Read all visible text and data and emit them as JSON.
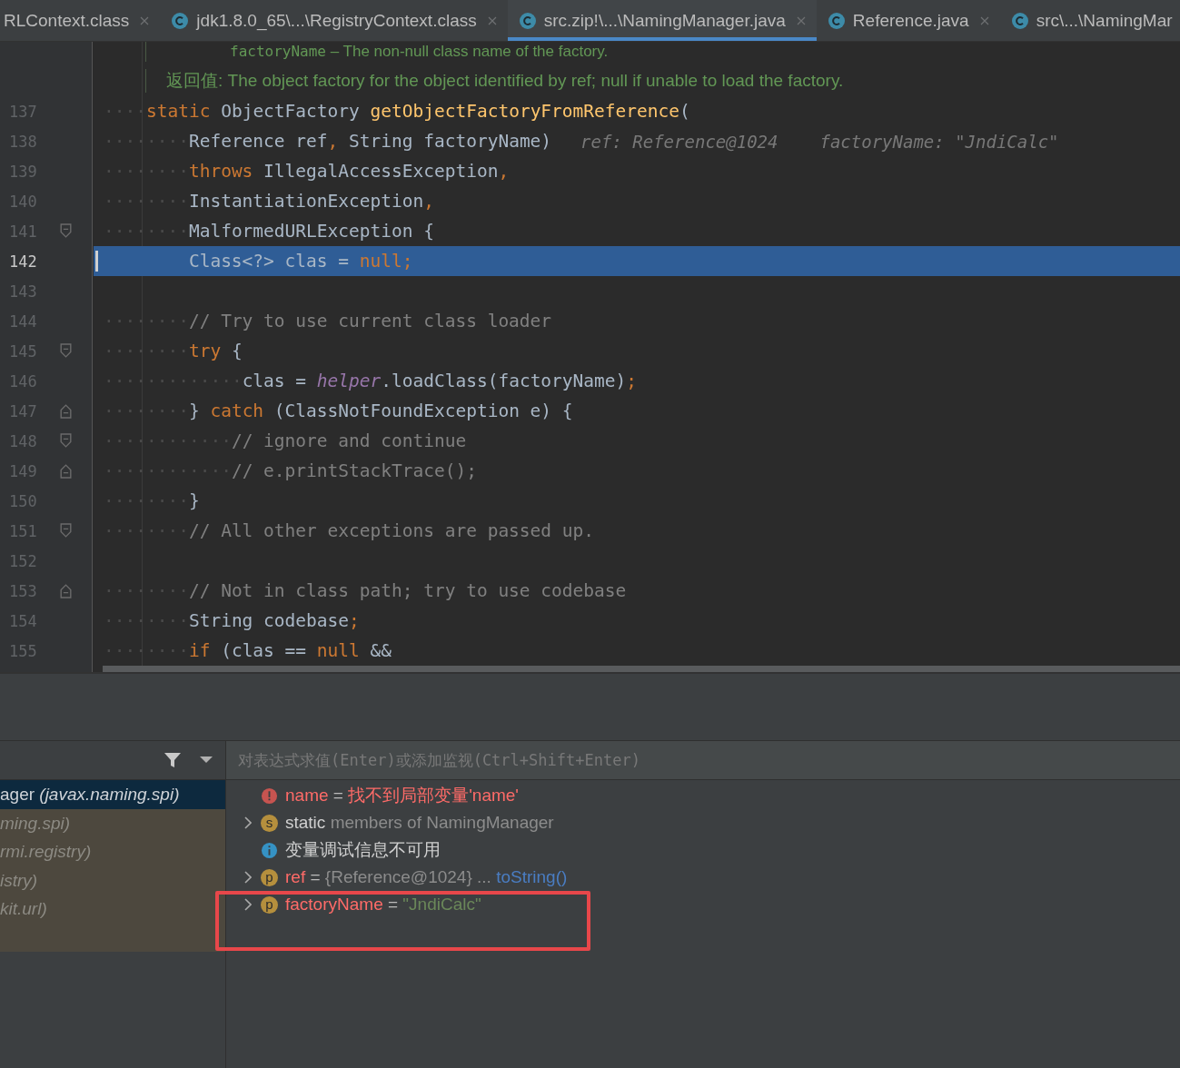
{
  "tabs": [
    {
      "label": "RLContext.class",
      "selected": false
    },
    {
      "label": "jdk1.8.0_65\\...\\RegistryContext.class",
      "selected": false
    },
    {
      "label": "src.zip!\\...\\NamingManager.java",
      "selected": true
    },
    {
      "label": "Reference.java",
      "selected": false
    },
    {
      "label": "src\\...\\NamingMar",
      "selected": false
    }
  ],
  "doc_lines": [
    {
      "indented": true,
      "tokens": [
        {
          "kind": "mono",
          "text": "factoryName"
        },
        {
          "kind": "sans",
          "text": " – The non-null class name of the factory."
        }
      ]
    },
    {
      "indented": false,
      "tokens": [
        {
          "kind": "sans",
          "text": "返回值: The object factory for the object identified by ref; null if unable to load the factory."
        }
      ]
    }
  ],
  "code_lines": [
    {
      "number": "137",
      "selected": false,
      "kind": "plain",
      "tokens": [
        {
          "kind": "ws",
          "text": "····"
        },
        {
          "kind": "kw",
          "text": "static"
        },
        {
          "kind": "plain",
          "text": " ObjectFactory "
        },
        {
          "kind": "fn",
          "text": "getObjectFactoryFromReference"
        },
        {
          "kind": "plain",
          "text": "("
        }
      ]
    },
    {
      "number": "138",
      "selected": false,
      "kind": "plain",
      "tokens": [
        {
          "kind": "ws",
          "text": "········"
        },
        {
          "kind": "plain",
          "text": "Reference ref"
        },
        {
          "kind": "kw",
          "text": ","
        },
        {
          "kind": "plain",
          "text": " String factoryName)"
        }
      ],
      "hints": [
        "ref: Reference@1024",
        "factoryName: \"JndiCalc\""
      ]
    },
    {
      "number": "139",
      "selected": false,
      "kind": "plain",
      "tokens": [
        {
          "kind": "ws",
          "text": "········"
        },
        {
          "kind": "kw",
          "text": "throws"
        },
        {
          "kind": "plain",
          "text": " IllegalAccessException"
        },
        {
          "kind": "kw",
          "text": ","
        }
      ]
    },
    {
      "number": "140",
      "selected": false,
      "kind": "plain",
      "tokens": [
        {
          "kind": "ws",
          "text": "········"
        },
        {
          "kind": "plain",
          "text": "InstantiationException"
        },
        {
          "kind": "kw",
          "text": ","
        }
      ]
    },
    {
      "number": "141",
      "selected": false,
      "kind": "fold-start",
      "tokens": [
        {
          "kind": "ws",
          "text": "········"
        },
        {
          "kind": "plain",
          "text": "MalformedURLException {"
        }
      ]
    },
    {
      "number": "142",
      "selected": true,
      "kind": "plain",
      "tokens": [
        {
          "kind": "plain",
          "text": "Class<?> clas = "
        },
        {
          "kind": "kw",
          "text": "null;"
        }
      ]
    },
    {
      "number": "143",
      "selected": false,
      "kind": "plain"
    },
    {
      "number": "144",
      "selected": false,
      "kind": "plain",
      "tokens": [
        {
          "kind": "ws",
          "text": "········"
        },
        {
          "kind": "comment",
          "text": "// Try to use current class loader"
        }
      ]
    },
    {
      "number": "145",
      "selected": false,
      "kind": "fold-start",
      "tokens": [
        {
          "kind": "ws",
          "text": "········"
        },
        {
          "kind": "kw",
          "text": "try"
        },
        {
          "kind": "plain",
          "text": " {"
        }
      ]
    },
    {
      "number": "146",
      "selected": false,
      "kind": "plain",
      "tokens": [
        {
          "kind": "ws",
          "text": "·············"
        },
        {
          "kind": "plain",
          "text": "clas = "
        },
        {
          "kind": "field",
          "text": "helper"
        },
        {
          "kind": "plain",
          "text": ".loadClass(factoryName)"
        },
        {
          "kind": "kw",
          "text": ";"
        }
      ]
    },
    {
      "number": "147",
      "selected": false,
      "kind": "fold-end",
      "tokens": [
        {
          "kind": "ws",
          "text": "········"
        },
        {
          "kind": "plain",
          "text": "} "
        },
        {
          "kind": "kw",
          "text": "catch"
        },
        {
          "kind": "plain",
          "text": " (ClassNotFoundException e) {"
        }
      ]
    },
    {
      "number": "148",
      "selected": false,
      "kind": "fold-start",
      "tokens": [
        {
          "kind": "ws",
          "text": "············"
        },
        {
          "kind": "comment",
          "text": "// ignore and continue"
        }
      ]
    },
    {
      "number": "149",
      "selected": false,
      "kind": "fold-end",
      "tokens": [
        {
          "kind": "ws",
          "text": "············"
        },
        {
          "kind": "comment",
          "text": "// e.printStackTrace();"
        }
      ]
    },
    {
      "number": "150",
      "selected": false,
      "kind": "plain",
      "tokens": [
        {
          "kind": "ws",
          "text": "········"
        },
        {
          "kind": "plain",
          "text": "}"
        }
      ]
    },
    {
      "number": "151",
      "selected": false,
      "kind": "fold-start",
      "tokens": [
        {
          "kind": "ws",
          "text": "········"
        },
        {
          "kind": "comment",
          "text": "// All other exceptions are passed up."
        }
      ]
    },
    {
      "number": "152",
      "selected": false,
      "kind": "plain"
    },
    {
      "number": "153",
      "selected": false,
      "kind": "fold-end",
      "tokens": [
        {
          "kind": "ws",
          "text": "········"
        },
        {
          "kind": "comment",
          "text": "// Not in class path; try to use codebase"
        }
      ]
    },
    {
      "number": "154",
      "selected": false,
      "kind": "plain",
      "tokens": [
        {
          "kind": "ws",
          "text": "········"
        },
        {
          "kind": "plain",
          "text": "String codebase"
        },
        {
          "kind": "kw",
          "text": ";"
        }
      ]
    },
    {
      "number": "155",
      "selected": false,
      "kind": "plain",
      "tokens": [
        {
          "kind": "ws",
          "text": "········"
        },
        {
          "kind": "kw",
          "text": "if"
        },
        {
          "kind": "plain",
          "text": " (clas == "
        },
        {
          "kind": "kw",
          "text": "null"
        },
        {
          "kind": "plain",
          "text": " &&"
        }
      ]
    }
  ],
  "frames": [
    {
      "text": "ager *(javax.naming.spi)*",
      "selected": true
    },
    {
      "text": "ming.spi)",
      "selected": false
    },
    {
      "text": "rmi.registry)",
      "selected": false
    },
    {
      "text": "istry)",
      "selected": false
    },
    {
      "text": "kit.url)",
      "selected": false
    }
  ],
  "evaluate": {
    "placeholder": "对表达式求值(Enter)或添加监视(Ctrl+Shift+Enter)"
  },
  "variables": [
    {
      "kind": "error",
      "expandable": false,
      "tokens": [
        {
          "kind": "err",
          "text": "name"
        },
        {
          "kind": "op",
          "text": " = "
        },
        {
          "kind": "err",
          "text": "找不到局部变量'name'"
        }
      ]
    },
    {
      "kind": "static",
      "badge": "s",
      "expandable": true,
      "tokens": [
        {
          "kind": "name",
          "text": "static"
        },
        {
          "kind": "dim",
          "text": " members of NamingManager"
        }
      ]
    },
    {
      "kind": "info",
      "expandable": false,
      "tokens": [
        {
          "kind": "name",
          "text": "变量调试信息不可用"
        }
      ]
    },
    {
      "kind": "param",
      "badge": "p",
      "expandable": true,
      "tokens": [
        {
          "kind": "err",
          "text": "ref"
        },
        {
          "kind": "op",
          "text": " = "
        },
        {
          "kind": "dim",
          "text": "{Reference@1024} ... "
        },
        {
          "kind": "link",
          "text": "toString()"
        }
      ]
    },
    {
      "kind": "param",
      "badge": "p",
      "expandable": true,
      "tokens": [
        {
          "kind": "err",
          "text": "factoryName"
        },
        {
          "kind": "op",
          "text": " = "
        },
        {
          "kind": "str",
          "text": "\"JndiCalc\""
        }
      ]
    }
  ]
}
